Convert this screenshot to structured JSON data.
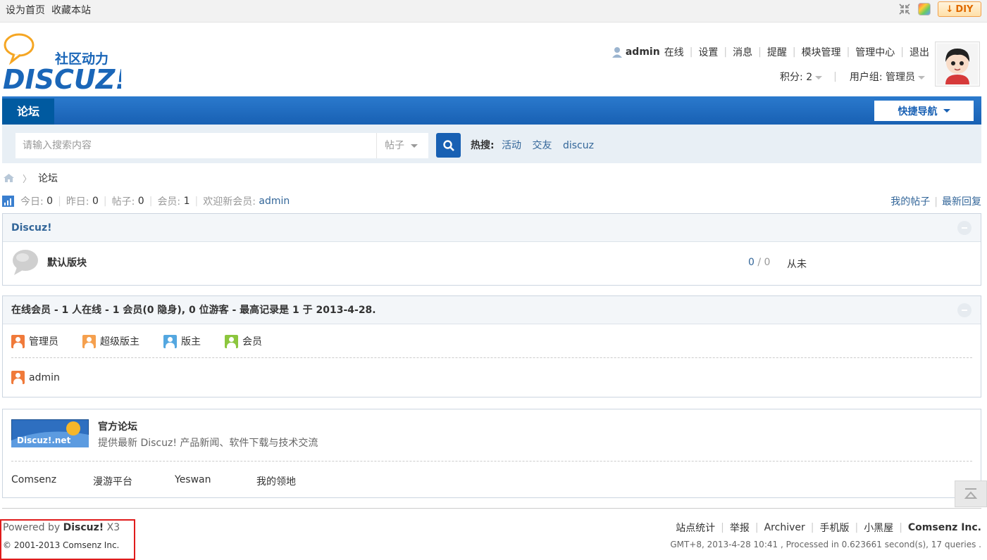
{
  "topbar": {
    "set_home": "设为首页",
    "bookmark": "收藏本站",
    "diy_label": "DIY"
  },
  "logo": {
    "tagline": "社区动力",
    "brand": "DISCUZ!"
  },
  "user_nav": {
    "username": "admin",
    "status": "在线",
    "items": [
      "设置",
      "消息",
      "提醒",
      "模块管理",
      "管理中心",
      "退出"
    ],
    "credits": "积分: 2",
    "usergroup": "用户组: 管理员"
  },
  "nav": {
    "forum_tab": "论坛",
    "quick_nav": "快捷导航"
  },
  "search": {
    "placeholder": "请输入搜索内容",
    "type": "帖子",
    "hot_label": "热搜:",
    "hot_words": [
      "活动",
      "交友",
      "discuz"
    ]
  },
  "breadcrumb": {
    "current": "论坛"
  },
  "stats": {
    "today_label": "今日:",
    "today": "0",
    "yesterday_label": "昨日:",
    "yesterday": "0",
    "posts_label": "帖子:",
    "posts": "0",
    "members_label": "会员:",
    "members": "1",
    "welcome_label": "欢迎新会员:",
    "newest": "admin",
    "my_posts": "我的帖子",
    "latest_replies": "最新回复"
  },
  "category": {
    "title": "Discuz!",
    "forum_name": "默认版块",
    "threads": "0",
    "posts": "0",
    "last_post": "从未"
  },
  "online": {
    "title": "在线会员 - 1 人在线 - 1 会员(0 隐身), 0 位游客 - 最高记录是 1 于 2013-4-28.",
    "legend": [
      {
        "label": "管理员",
        "color": "#f07a3a"
      },
      {
        "label": "超级版主",
        "color": "#f5a04e"
      },
      {
        "label": "版主",
        "color": "#54a7e0"
      },
      {
        "label": "会员",
        "color": "#8cc63e"
      }
    ],
    "users": [
      "admin"
    ]
  },
  "links": {
    "logo_text": "Discuz!.net",
    "title": "官方论坛",
    "description": "提供最新 Discuz! 产品新闻、软件下载与技术交流",
    "items": [
      "Comsenz",
      "漫游平台",
      "Yeswan",
      "我的领地"
    ]
  },
  "footer": {
    "powered_by": "Powered by",
    "product": "Discuz!",
    "version": "X3",
    "copyright": "© 2001-2013 Comsenz Inc.",
    "links": [
      "站点统计",
      "举报",
      "Archiver",
      "手机版",
      "小黑屋"
    ],
    "brand": "Comsenz Inc.",
    "meta": "GMT+8, 2013-4-28 10:41 , Processed in 0.623661 second(s), 17 queries ."
  },
  "colors": {
    "nav_blue": "#1860b3",
    "link_blue": "#336699",
    "footer_highlight": "#e01b1b"
  }
}
